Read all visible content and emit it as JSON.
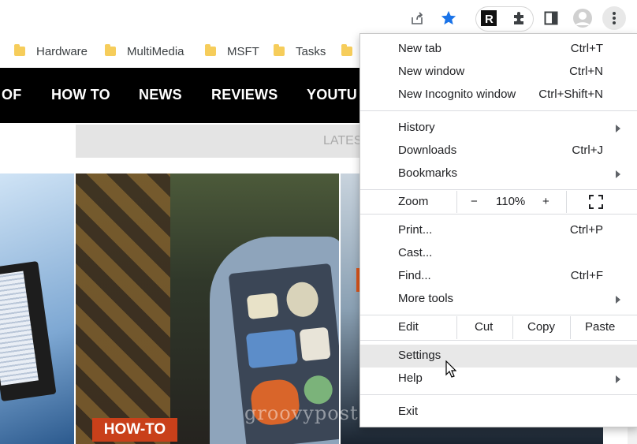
{
  "toolbar": {
    "icons": [
      "share-icon",
      "bookmark-star-icon",
      "extension-r-icon",
      "puzzle-icon",
      "side-panel-icon",
      "profile-icon",
      "kebab-menu-icon"
    ],
    "star_color": "#1a73e8"
  },
  "bookmarks": [
    {
      "label": "Hardware"
    },
    {
      "label": "MultiMedia"
    },
    {
      "label": "MSFT"
    },
    {
      "label": "Tasks"
    }
  ],
  "site_nav": {
    "items": [
      "OF",
      "HOW TO",
      "NEWS",
      "REVIEWS",
      "YOUTU"
    ]
  },
  "latest_label": "LATES",
  "howto_badge": "HOW-TO",
  "watermark": "groovypost.com",
  "menu": {
    "new_tab": {
      "label": "New tab",
      "shortcut": "Ctrl+T"
    },
    "new_window": {
      "label": "New window",
      "shortcut": "Ctrl+N"
    },
    "new_incognito": {
      "label": "New Incognito window",
      "shortcut": "Ctrl+Shift+N"
    },
    "history": {
      "label": "History"
    },
    "downloads": {
      "label": "Downloads",
      "shortcut": "Ctrl+J"
    },
    "bookmarks": {
      "label": "Bookmarks"
    },
    "zoom": {
      "label": "Zoom",
      "minus": "−",
      "value": "110%",
      "plus": "+"
    },
    "print": {
      "label": "Print...",
      "shortcut": "Ctrl+P"
    },
    "cast": {
      "label": "Cast..."
    },
    "find": {
      "label": "Find...",
      "shortcut": "Ctrl+F"
    },
    "more_tools": {
      "label": "More tools"
    },
    "edit": {
      "label": "Edit",
      "cut": "Cut",
      "copy": "Copy",
      "paste": "Paste"
    },
    "settings": {
      "label": "Settings"
    },
    "help": {
      "label": "Help"
    },
    "exit": {
      "label": "Exit"
    }
  }
}
